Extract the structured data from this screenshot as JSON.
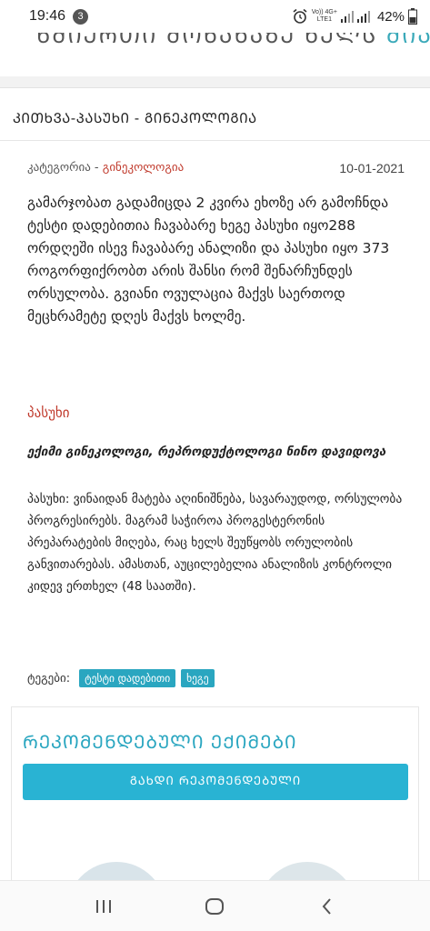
{
  "status_bar": {
    "time": "19:46",
    "notification_count": "3",
    "network_top": "Vo)) 4G+",
    "network_bottom": "LTE1",
    "battery": "42%"
  },
  "top_partial": {
    "text": "ᲬᲛᲘᲔᲠᲗᲘ ᲛᲝᲜᲐᲮᲐᲖᲔ ᲮᲔᲚᲡ",
    "accent_text": "ᲛᲘᲐᲙᲐ"
  },
  "card": {
    "title": "ᲙᲘᲗᲮᲕᲐ-ᲞᲐᲡᲣᲮᲘ - ᲒᲘᲜᲔᲙᲝᲚᲝᲒᲘᲐ",
    "category_label": "კატეგორია",
    "category_sep": " - ",
    "category_value": "გინეკოლოგია",
    "date": "10-01-2021",
    "question": "გამარჯობათ გადამიცდა 2 კვირა ეხოზე არ გამოჩნდა ტესტი დადებითია ჩავაბარე ხეგე პასუხი იყო288 ორდღეში ისევ ჩავაბარე ანალიზი და პასუხი იყო 373 როგორფიქრობთ არის შანსი რომ შენარჩუნდეს ორსულობა. გვიანი ოვულაცია მაქვს საერთოდ მეცხრამეტე დღეს მაქვს ხოლმე.",
    "answer_label": "პასუხი",
    "doctor": "ექიმი გინეკოლოგი, რეპროდუქტოლოგი ნინო დავიდოვა",
    "answer": "პასუხი: ვინაიდან მატება აღინიშნება, სავარაუდოდ, ორსულობა პროგრესირებს. მაგრამ საჭიროა პროგესტერონის პრეპარატების მიღება, რაც ხელს შეუწყობს ორულობის განვითარებას. ამასთან, აუცილებელია ანალიზის კონტროლი კიდევ ერთხელ (48 საათში).",
    "tags_label": "ტეგები:",
    "tags": [
      "ტესტი დადებითი",
      "ხეგე"
    ]
  },
  "recommended": {
    "title": "ᲠᲔᲙᲝᲛᲔᲜᲓᲔᲑᲣᲚᲘ ᲔᲥᲘᲛᲔᲑᲘ",
    "button_label": "ᲒᲐᲮᲓᲘ ᲠᲔᲙᲝᲛᲔᲜᲓᲔᲑᲣᲚᲘ"
  },
  "colors": {
    "accent": "#2aa6c0",
    "button": "#29b3d3",
    "category": "#c0392b"
  },
  "icons": {
    "alarm": "alarm-icon",
    "signal": "signal-icon",
    "battery": "battery-icon",
    "recent": "recent-apps-icon",
    "home": "home-icon",
    "back": "back-icon"
  }
}
